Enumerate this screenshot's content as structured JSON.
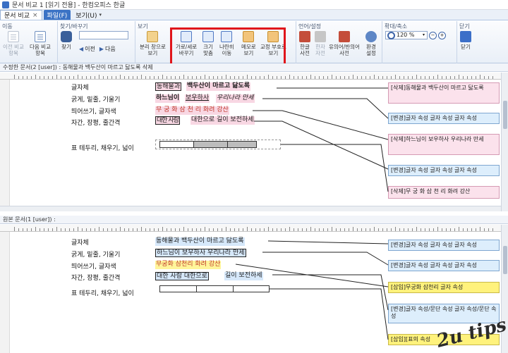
{
  "window": {
    "title": "문서 비교 1 [읽기 전용] - 한컴오피스 한글"
  },
  "menu": {
    "active_tab": "문서 비교",
    "close_glyph": "×",
    "file_tab": "파일(F)",
    "view_tab": "보기(U)",
    "dropdown_glyph": "▾"
  },
  "ribbon": {
    "groups": {
      "move": "이동",
      "find": "찾기/바꾸기",
      "view": "보기",
      "lang": "언어/설정",
      "zoom": "확대/축소",
      "close": "닫기"
    },
    "buttons": {
      "prev_compare": "이전 비교\n항목",
      "next_compare": "다음 비교\n항목",
      "find": "찾기",
      "prev": "이전",
      "next": "다음",
      "split_view": "분리 창으로\n보기",
      "hv_split": "가로/세로\n바꾸기",
      "fit_size": "크기\n맞춤",
      "sync_move": "나란히\n이동",
      "memo_view": "메모로\n보기",
      "proof_view": "교정 부호로\n보기",
      "hanja_dict": "한글\n사전",
      "hanja_dict2": "한자\n자전",
      "synonym_dict": "유의어/반의어\n사전",
      "env_settings": "환경\n설정",
      "close": "닫기"
    },
    "zoom_value": "120 %",
    "zoom_out": "−",
    "zoom_in": "+",
    "find_arrow_prev": "◀",
    "find_arrow_next": "▶"
  },
  "top_pane": {
    "header": "수정한 문서(2 [user]) : 동해물과 백두산이 마르고 닳도록 삭제",
    "labels": [
      "글자체",
      "굵게, 밑줄, 기울기",
      "띄어쓰기, 글자색",
      "자간, 장평, 줄간격",
      "표 테두리, 채우기, 넓이"
    ],
    "texts": [
      {
        "a": "동해물과",
        "b": "백두산이 마르고 닳도록"
      },
      {
        "a": "하느님이",
        "b": "보우하사",
        "c": "우리나라 만세"
      },
      {
        "a": "무 궁 화   삼 천 리 화려 강산"
      },
      {
        "a": "대한 사람",
        "b": "대한으로 길이 보전하세"
      }
    ],
    "notes": [
      "[삭제]동해물과 백두산이 마르고 닳도록",
      "[변경]글자 속성 글자 속성 글자 속성",
      "[삭제]하느님이 보우하사 우리나라 만세",
      "[변경]글자 속성 글자 속성 글자 속성",
      "[삭제]무 궁 화  삼 천 리 화려 강산"
    ]
  },
  "bottom_pane": {
    "header": "원본 문서(1 [user]) :",
    "labels": [
      "글자체",
      "굵게, 밑줄, 기울기",
      "띄어쓰기, 글자색",
      "자간, 장평, 줄간격",
      "표 테두리, 채우기, 넓이"
    ],
    "texts": [
      "동해물과 백두산이 마르고 닳도록",
      "하느님이 보우하사 우리나라 만세",
      "무궁화 삼천리 화려 강산",
      {
        "a": "대한 사람 대한으로",
        "b": "길이 보전하세"
      }
    ],
    "notes": [
      "[변경]글자 속성 글자 속성 글자 속성",
      "[변경]글자 속성 글자 속성 글자 속성",
      "[삽입]무궁화 삼천리 글자 속성",
      "[변경]글자 속성/문단 속성 글자 속성/문단 속성",
      "[삽입][표의 속성"
    ]
  },
  "watermark": "2u tips"
}
